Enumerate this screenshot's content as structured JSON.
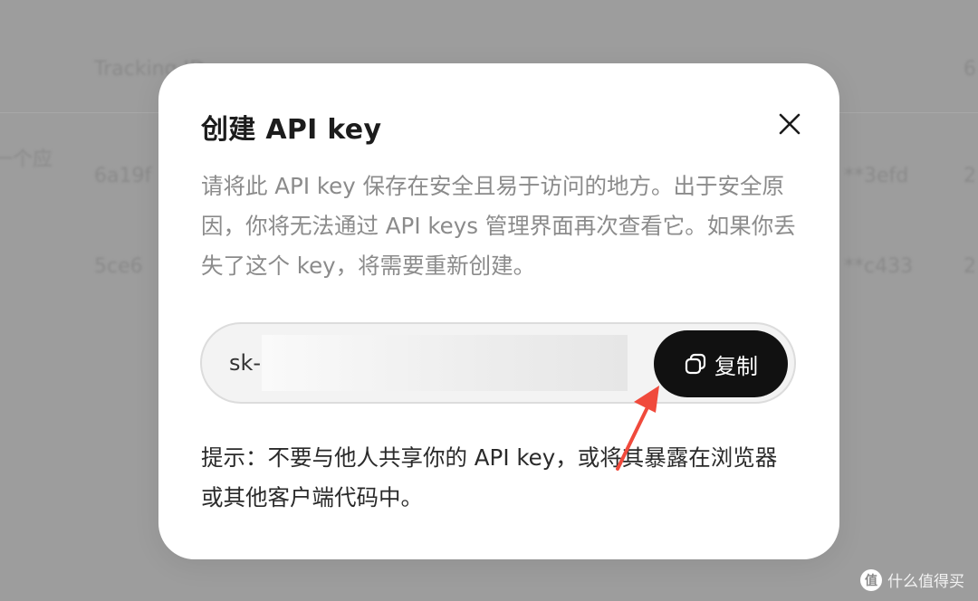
{
  "background": {
    "header_col1": "Tracking ID",
    "row_label": "一个应",
    "rows": [
      {
        "id": "6a19f",
        "key": "**3efd",
        "extra": "2"
      },
      {
        "id": "5ce6",
        "key": "**c433",
        "extra": "2"
      }
    ],
    "header_col3": "6"
  },
  "modal": {
    "title": "创建 API key",
    "description": "请将此 API key 保存在安全且易于访问的地方。出于安全原因，你将无法通过 API keys 管理界面再次查看它。如果你丢失了这个 key，将需要重新创建。",
    "key_prefix": "sk-",
    "copy_label": "复制",
    "hint": "提示：不要与他人共享你的 API key，或将其暴露在浏览器或其他客户端代码中。",
    "close_icon": "close-icon",
    "copy_icon": "copy-icon"
  },
  "annotation": {
    "arrow_color": "#f04a3c"
  },
  "watermark": {
    "logo_text": "值",
    "text": "什么值得买"
  }
}
